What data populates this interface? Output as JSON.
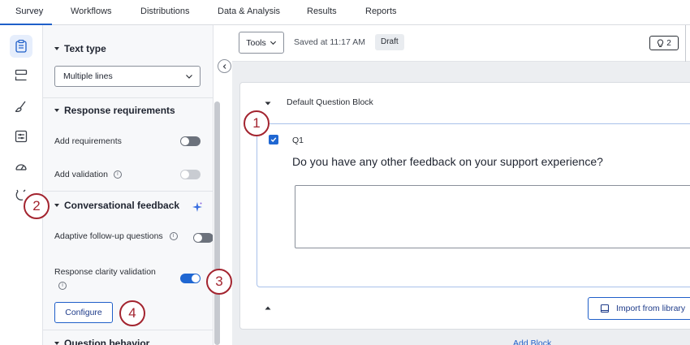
{
  "topnav": {
    "tabs": [
      "Survey",
      "Workflows",
      "Distributions",
      "Data & Analysis",
      "Results",
      "Reports"
    ],
    "active": "Survey"
  },
  "rail": {
    "icons": [
      "survey-flow-icon",
      "blocks-icon",
      "brush-icon",
      "options-icon",
      "gauge-icon",
      "ideas-icon"
    ]
  },
  "panel": {
    "text_type": {
      "heading": "Text type",
      "select_value": "Multiple lines"
    },
    "response_requirements": {
      "heading": "Response requirements",
      "add_requirements": "Add requirements",
      "add_validation": "Add validation"
    },
    "conversational_feedback": {
      "heading": "Conversational feedback",
      "adaptive_followup": "Adaptive follow-up questions",
      "response_clarity": "Response clarity validation",
      "configure": "Configure"
    },
    "question_behavior": {
      "heading": "Question behavior"
    },
    "toggles": {
      "add_requirements": "off",
      "add_validation": "disabled",
      "adaptive_followup": "off",
      "response_clarity": "on"
    }
  },
  "toolbar": {
    "tools": "Tools",
    "saved": "Saved at 11:17 AM",
    "draft": "Draft",
    "count": "2"
  },
  "block": {
    "title": "Default Question Block",
    "question_id": "Q1",
    "question_text": "Do you have any other feedback on your support experience?",
    "import_button": "Import from library",
    "add_block": "Add Block"
  },
  "callouts": [
    "1",
    "2",
    "3",
    "4"
  ],
  "colors": {
    "accent": "#1f67d2",
    "callout": "#a3242f"
  }
}
